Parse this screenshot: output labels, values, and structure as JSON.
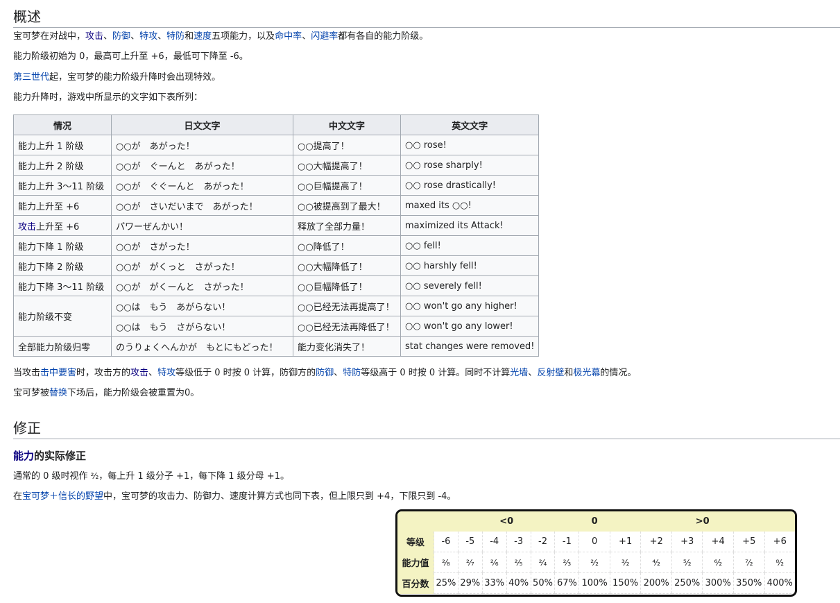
{
  "section1": {
    "heading": "概述",
    "p1": {
      "t0": "宝可梦在对战中，",
      "l1": "攻击",
      "t1": "、",
      "l2": "防御",
      "t2": "、",
      "l3": "特攻",
      "t3": "、",
      "l4": "特防",
      "t4": "和",
      "l5": "速度",
      "t5": "五项能力，以及",
      "l6": "命中率",
      "t6": "、",
      "l7": "闪避率",
      "t7": "都有各自的能力阶级。"
    },
    "p2": "能力阶级初始为 0，最高可上升至 +6，最低可下降至 -6。",
    "p3": {
      "link": "第三世代",
      "text": "起，宝可梦的能力阶级升降时会出现特效。"
    },
    "p4": "能力升降时，游戏中所显示的文字如下表所列："
  },
  "message_table": {
    "headers": [
      "情况",
      "日文文字",
      "中文文字",
      "英文文字"
    ],
    "rows": [
      {
        "situation": "能力上升 1 阶级",
        "ja": "○○が　あがった！",
        "zh": "○○提高了！",
        "en": "○○ rose!"
      },
      {
        "situation": "能力上升 2 阶级",
        "ja": "○○が　ぐーんと　あがった！",
        "zh": "○○大幅提高了！",
        "en": "○○ rose sharply!"
      },
      {
        "situation": "能力上升 3～11 阶级",
        "ja": "○○が　ぐぐーんと　あがった！",
        "zh": "○○巨幅提高了！",
        "en": "○○ rose drastically!"
      },
      {
        "situation": "能力上升至 +6",
        "ja": "○○が　さいだいまで　あがった！",
        "zh": "○○被提高到了最大！",
        "en": "maxed its ○○!"
      },
      {
        "situation_link": "攻击",
        "situation": "上升至 +6",
        "ja": "パワーぜんかい！",
        "zh": "释放了全部力量！",
        "en": "maximized its Attack!"
      },
      {
        "situation": "能力下降 1 阶级",
        "ja": "○○が　さがった！",
        "zh": "○○降低了！",
        "en": "○○ fell!"
      },
      {
        "situation": "能力下降 2 阶级",
        "ja": "○○が　がくっと　さがった！",
        "zh": "○○大幅降低了！",
        "en": "○○ harshly fell!"
      },
      {
        "situation": "能力下降 3～11 阶级",
        "ja": "○○が　がくーんと　さがった！",
        "zh": "○○巨幅降低了！",
        "en": "○○ severely fell!"
      },
      {
        "situation": "能力阶级不变",
        "ja": "○○は　もう　あがらない！",
        "zh": "○○已经无法再提高了！",
        "en": "○○ won't go any higher!"
      },
      {
        "ja": "○○は　もう　さがらない！",
        "zh": "○○已经无法再降低了！",
        "en": "○○ won't go any lower!"
      },
      {
        "situation": "全部能力阶级归零",
        "ja": "のうりょくへんかが　もとにもどった！",
        "zh": "能力变化消失了！",
        "en": "stat changes were removed!"
      }
    ]
  },
  "p5": {
    "t0": "当攻击",
    "l1": "击中要害",
    "t1": "时，攻击方的",
    "l2": "攻击",
    "t2": "、",
    "l3": "特攻",
    "t3": "等级低于 0 时按 0 计算，防御方的",
    "l4": "防御",
    "t4": "、",
    "l5": "特防",
    "t5": "等级高于 0 时按 0 计算。同时不计算",
    "l6": "光墙",
    "t6": "、",
    "l7": "反射壁",
    "t7": "和",
    "l8": "极光幕",
    "t8": "的情况。"
  },
  "p6": {
    "t0": "宝可梦被",
    "link": "替换",
    "t1": "下场后，能力阶级会被重置为0。"
  },
  "section2": {
    "heading": "修正",
    "subheading_link": "能力",
    "subheading_text": "的实际修正",
    "p7": {
      "t0": "通常的 0 级时视作 ",
      "frac": "²⁄₂",
      "t1": "，每上升 1 级分子 +1，每下降 1 级分母 +1。"
    },
    "p8": {
      "t0": "在",
      "link": "宝可梦＋信长的野望",
      "t1": "中，宝可梦的攻击力、防御力、速度计算方式也同下表，但上限只到 +4，下限只到 -4。"
    }
  },
  "stage_table": {
    "groups": [
      "<0",
      "0",
      ">0"
    ],
    "row_labels": [
      "等级",
      "能力值",
      "百分数"
    ],
    "stages": [
      "-6",
      "-5",
      "-4",
      "-3",
      "-2",
      "-1",
      "0",
      "+1",
      "+2",
      "+3",
      "+4",
      "+5",
      "+6"
    ],
    "fractions": [
      "²⁄₈",
      "²⁄₇",
      "²⁄₆",
      "²⁄₅",
      "²⁄₄",
      "²⁄₃",
      "²⁄₂",
      "³⁄₂",
      "⁴⁄₂",
      "⁵⁄₂",
      "⁶⁄₂",
      "⁷⁄₂",
      "⁸⁄₂"
    ],
    "percents": [
      "25%",
      "29%",
      "33%",
      "40%",
      "50%",
      "67%",
      "100%",
      "150%",
      "200%",
      "250%",
      "300%",
      "350%",
      "400%"
    ]
  }
}
